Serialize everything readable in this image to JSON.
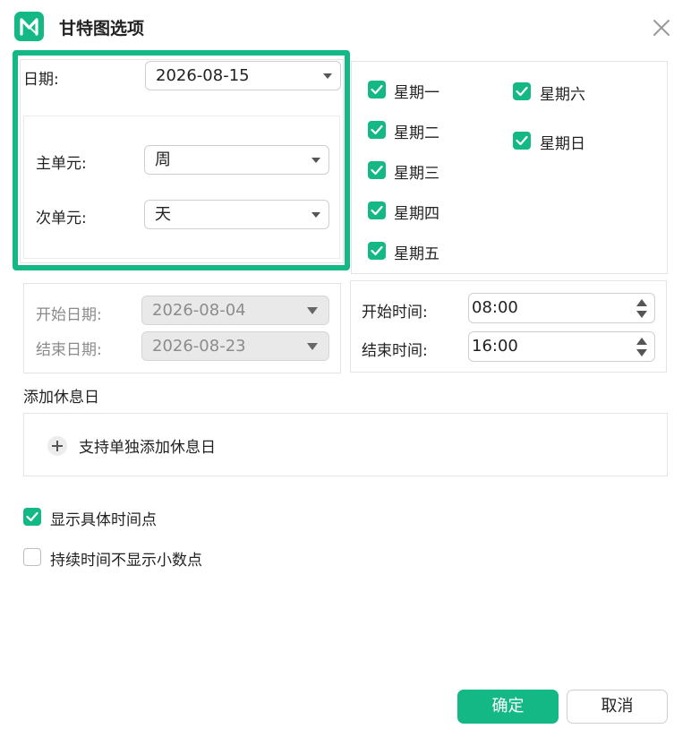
{
  "app": {
    "title": "甘特图选项"
  },
  "date_section": {
    "date_label": "日期:",
    "date_value": "2026-08-15",
    "major_unit_label": "主单元:",
    "major_unit_value": "周",
    "minor_unit_label": "次单元:",
    "minor_unit_value": "天"
  },
  "weekdays": [
    {
      "label": "星期一",
      "checked": true
    },
    {
      "label": "星期二",
      "checked": true
    },
    {
      "label": "星期三",
      "checked": true
    },
    {
      "label": "星期四",
      "checked": true
    },
    {
      "label": "星期五",
      "checked": true
    },
    {
      "label": "星期六",
      "checked": true
    },
    {
      "label": "星期日",
      "checked": true
    }
  ],
  "range_section": {
    "start_date_label": "开始日期:",
    "start_date_value": "2026-08-04",
    "end_date_label": "结束日期:",
    "end_date_value": "2026-08-23"
  },
  "time_section": {
    "start_time_label": "开始时间:",
    "start_time_value": "08:00",
    "end_time_label": "结束时间:",
    "end_time_value": "16:00"
  },
  "holidays": {
    "heading": "添加休息日",
    "add_label": "支持单独添加休息日"
  },
  "options": {
    "show_time_points": {
      "label": "显示具体时间点",
      "checked": true
    },
    "no_decimal_duration": {
      "label": "持续时间不显示小数点",
      "checked": false
    }
  },
  "footer": {
    "ok_label": "确定",
    "cancel_label": "取消"
  },
  "colors": {
    "accent": "#14b884"
  }
}
